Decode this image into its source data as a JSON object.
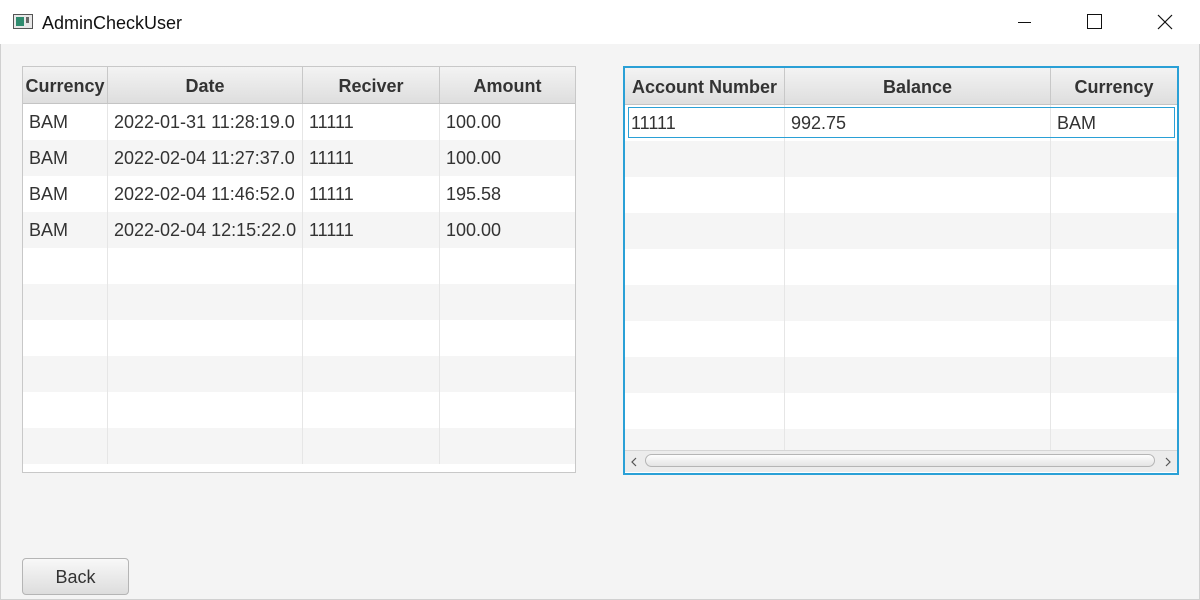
{
  "window": {
    "title": "AdminCheckUser",
    "icon": "java-app-icon"
  },
  "transactions_table": {
    "columns": [
      "Currency",
      "Date",
      "Reciver",
      "Amount"
    ],
    "rows": [
      [
        "BAM",
        "2022-01-31 11:28:19.0",
        "11111",
        "100.00"
      ],
      [
        "BAM",
        "2022-02-04 11:27:37.0",
        "11111",
        "100.00"
      ],
      [
        "BAM",
        "2022-02-04 11:46:52.0",
        "11111",
        "195.58"
      ],
      [
        "BAM",
        "2022-02-04 12:15:22.0",
        "11111",
        "100.00"
      ]
    ]
  },
  "accounts_table": {
    "columns": [
      "Account Number",
      "Balance",
      "Currency"
    ],
    "rows": [
      [
        "11111",
        "992.75",
        "BAM"
      ]
    ],
    "selected_row": 0
  },
  "buttons": {
    "back_label": "Back"
  },
  "colors": {
    "focus_border": "#2aa0d6",
    "background": "#f4f4f4"
  }
}
